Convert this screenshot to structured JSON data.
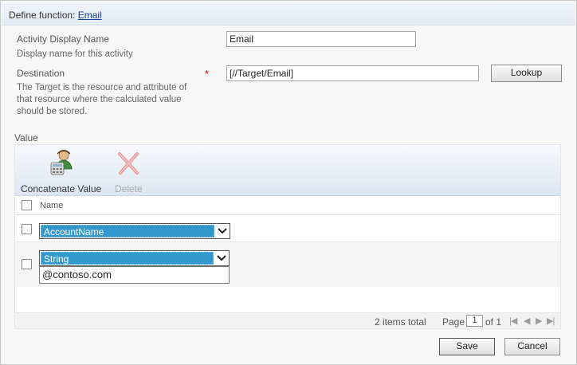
{
  "header": {
    "prefix": "Define function: ",
    "function_link": "Email"
  },
  "activity_name": {
    "label": "Activity Display Name",
    "description": "Display name for this activity",
    "value": "Email"
  },
  "destination": {
    "label": "Destination",
    "required_mark": "*",
    "description_lines": [
      "The Target is the resource and attribute of",
      "that resource where the calculated value",
      "should be stored."
    ],
    "value": "[//Target/Email]",
    "lookup_label": "Lookup"
  },
  "value_section": {
    "label": "Value",
    "toolbar": {
      "concatenate_label": "Concatenate Value",
      "delete_label": "Delete",
      "concatenate_icon": "user-calculator-icon",
      "delete_icon": "red-x-icon"
    },
    "grid": {
      "column_name": "Name",
      "rows": [
        {
          "select_value": "AccountName"
        },
        {
          "select_value": "String",
          "text_value": "@contoso.com"
        }
      ]
    },
    "footer": {
      "items_total": "2 items total",
      "page_label": "Page",
      "page_value": "1",
      "of_label": "of 1"
    }
  },
  "buttons": {
    "save": "Save",
    "cancel": "Cancel"
  },
  "colors": {
    "selection_blue": "#3399cc",
    "link_blue": "#1a3f9c",
    "required_red": "#d00000"
  }
}
